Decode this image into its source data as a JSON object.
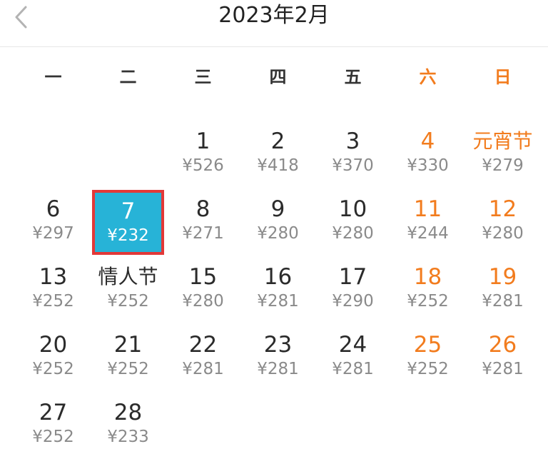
{
  "header": {
    "title": "2023年2月",
    "back_icon": "chevron-left-icon"
  },
  "colors": {
    "accent": "#27b3d7",
    "weekend": "#f27c1e",
    "selection_border": "#e23838"
  },
  "weekdays": [
    "一",
    "二",
    "三",
    "四",
    "五",
    "六",
    "日"
  ],
  "calendar": {
    "rows": [
      [
        {
          "day": "",
          "price": ""
        },
        {
          "day": "",
          "price": ""
        },
        {
          "day": "1",
          "price": "¥526"
        },
        {
          "day": "2",
          "price": "¥418"
        },
        {
          "day": "3",
          "price": "¥370"
        },
        {
          "day": "4",
          "price": "¥330"
        },
        {
          "day": "元宵节",
          "price": "¥279"
        }
      ],
      [
        {
          "day": "6",
          "price": "¥297"
        },
        {
          "day": "7",
          "price": "¥232",
          "selected": true
        },
        {
          "day": "8",
          "price": "¥271"
        },
        {
          "day": "9",
          "price": "¥280"
        },
        {
          "day": "10",
          "price": "¥280"
        },
        {
          "day": "11",
          "price": "¥244"
        },
        {
          "day": "12",
          "price": "¥280"
        }
      ],
      [
        {
          "day": "13",
          "price": "¥252"
        },
        {
          "day": "情人节",
          "price": "¥252"
        },
        {
          "day": "15",
          "price": "¥280"
        },
        {
          "day": "16",
          "price": "¥281"
        },
        {
          "day": "17",
          "price": "¥290"
        },
        {
          "day": "18",
          "price": "¥252"
        },
        {
          "day": "19",
          "price": "¥281"
        }
      ],
      [
        {
          "day": "20",
          "price": "¥252"
        },
        {
          "day": "21",
          "price": "¥252"
        },
        {
          "day": "22",
          "price": "¥281"
        },
        {
          "day": "23",
          "price": "¥281"
        },
        {
          "day": "24",
          "price": "¥281"
        },
        {
          "day": "25",
          "price": "¥252"
        },
        {
          "day": "26",
          "price": "¥281"
        }
      ],
      [
        {
          "day": "27",
          "price": "¥252"
        },
        {
          "day": "28",
          "price": "¥233"
        }
      ]
    ]
  }
}
